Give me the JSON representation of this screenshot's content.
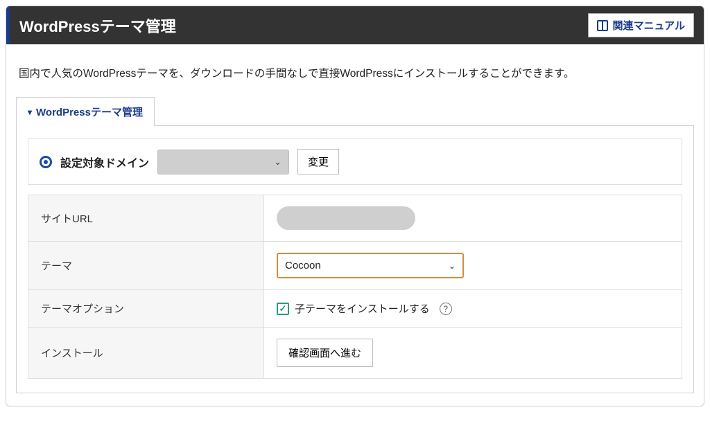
{
  "header": {
    "title": "WordPressテーマ管理",
    "manual_button": "関連マニュアル"
  },
  "description": "国内で人気のWordPressテーマを、ダウンロードの手間なしで直接WordPressにインストールすることができます。",
  "tab": {
    "label": "WordPressテーマ管理"
  },
  "domain_row": {
    "label": "設定対象ドメイン",
    "change_button": "変更"
  },
  "form": {
    "site_url": {
      "label": "サイトURL"
    },
    "theme": {
      "label": "テーマ",
      "value": "Cocoon"
    },
    "theme_option": {
      "label": "テーマオプション",
      "checkbox_label": "子テーマをインストールする"
    },
    "install": {
      "label": "インストール",
      "button": "確認画面へ進む"
    }
  }
}
